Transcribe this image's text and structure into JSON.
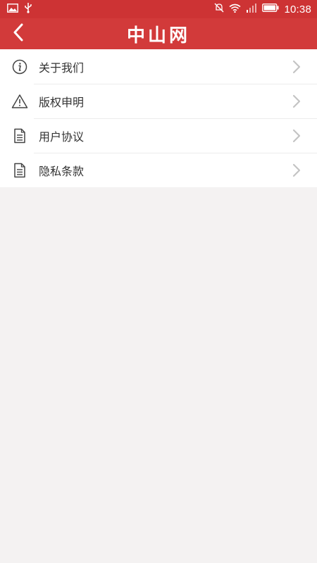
{
  "status_bar": {
    "time": "10:38",
    "icons": [
      "image-icon",
      "usb-icon",
      "mute-icon",
      "wifi-icon",
      "signal-icon",
      "battery-icon"
    ]
  },
  "header": {
    "title": "中山网",
    "back_icon": "chevron-left-icon"
  },
  "menu": {
    "items": [
      {
        "label": "关于我们",
        "icon": "info-icon"
      },
      {
        "label": "版权申明",
        "icon": "warning-icon"
      },
      {
        "label": "用户协议",
        "icon": "document-icon"
      },
      {
        "label": "隐私条款",
        "icon": "document-icon"
      }
    ]
  },
  "colors": {
    "header_bg": "#d23a3a",
    "status_bg": "#cd3334",
    "page_bg": "#f4f2f2",
    "text": "#333333",
    "chevron": "#c4c4c4"
  }
}
